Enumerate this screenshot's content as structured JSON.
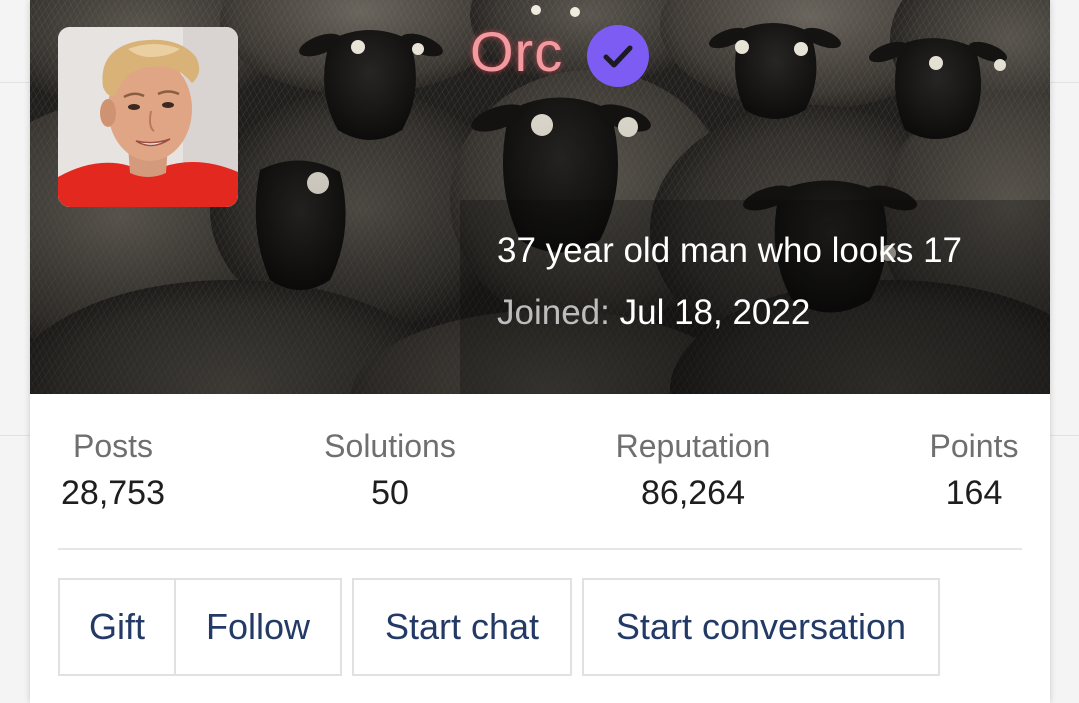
{
  "profile": {
    "username": "Orc",
    "tagline": "37 year old man who looks 17",
    "joined_label": "Joined:",
    "joined_date": "Jul 18, 2022",
    "verified": true
  },
  "stats": [
    {
      "label": "Posts",
      "value": "28,753"
    },
    {
      "label": "Solutions",
      "value": "50"
    },
    {
      "label": "Reputation",
      "value": "86,264"
    },
    {
      "label": "Points",
      "value": "164"
    }
  ],
  "actions": [
    {
      "label": "Gift"
    },
    {
      "label": "Follow"
    },
    {
      "label": "Start chat"
    },
    {
      "label": "Start conversation"
    }
  ],
  "colors": {
    "username": "#f39aa0",
    "verified_badge": "#7d5cf4",
    "button_text": "#243a66",
    "stat_label": "#6f6f6f"
  },
  "icons": {
    "verified": "check-badge-icon"
  }
}
